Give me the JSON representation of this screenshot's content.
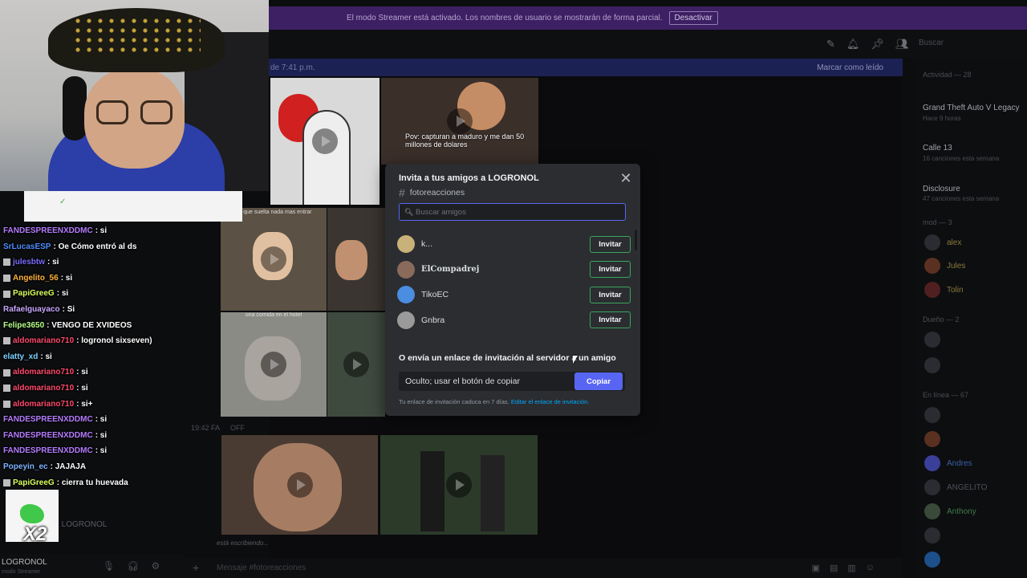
{
  "banner": {
    "text": "El modo Streamer está activado. Los nombres de usuario se mostrarán de forma parcial.",
    "button": "Desactivar"
  },
  "topbar": {
    "search_placeholder": "Buscar"
  },
  "newbar": {
    "left": "de 7:41 p.m.",
    "right": "Marcar como leído"
  },
  "chat_area": {
    "meta1": "19:42 FA",
    "meta1b": "OFF",
    "typing": "está escribiendo...",
    "message_placeholder": "Mensaje #fotoreacciones",
    "thumb_caption_1": "Pov: capturan a maduro y me dan 50 millones de dolares",
    "thumb_caption_2": "Lo que suelta nada mas entrar",
    "thumb_caption_3": "una comida en el hotel"
  },
  "right_panel": {
    "activity_header": "Actividad — 28",
    "activities": [
      {
        "title": "Grand Theft Auto V Legacy",
        "sub": "Hace 9 horas"
      },
      {
        "title": "Calle 13",
        "sub": "16 canciones esta semana"
      },
      {
        "title": "Disclosure",
        "sub": "47 canciones esta semana"
      }
    ],
    "mod_header": "mod — 3",
    "mods": [
      "alex",
      "Jules",
      "Tolin"
    ],
    "owner_header": "Dueño — 2",
    "online_header": "En línea — 67",
    "online": [
      "Andres",
      "ANGELITO",
      "Anthony"
    ]
  },
  "stream_chat": [
    {
      "user": "FANDESPREENXDDMC",
      "msg": "si",
      "color": "#b57cff",
      "badge": false
    },
    {
      "user": "SrLucasESP",
      "msg": "Oe Cómo entró al ds",
      "color": "#4f8cff",
      "badge": false
    },
    {
      "user": "julesbtw",
      "msg": "si",
      "color": "#7c6bff",
      "badge": true
    },
    {
      "user": "Angelito_56",
      "msg": "si",
      "color": "#ffb23c",
      "badge": true
    },
    {
      "user": "PapiGreeG",
      "msg": "si",
      "color": "#d8ff5b",
      "badge": true
    },
    {
      "user": "Rafaelguayaco",
      "msg": "Si",
      "color": "#c8a7ff",
      "badge": false
    },
    {
      "user": "Felipe3650",
      "msg": "VENGO DE XVIDEOS",
      "color": "#b6ff86",
      "badge": false
    },
    {
      "user": "aldomariano710",
      "msg": "logronol sixseven)",
      "color": "#ff4a6b",
      "badge": true
    },
    {
      "user": "elatty_xd",
      "msg": "si",
      "color": "#7dd3ff",
      "badge": false
    },
    {
      "user": "aldomariano710",
      "msg": "si",
      "color": "#ff4a6b",
      "badge": true
    },
    {
      "user": "aldomariano710",
      "msg": "si",
      "color": "#ff4a6b",
      "badge": true
    },
    {
      "user": "aldomariano710",
      "msg": "si+",
      "color": "#ff4a6b",
      "badge": true
    },
    {
      "user": "FANDESPREENXDDMC",
      "msg": "si",
      "color": "#b57cff",
      "badge": false
    },
    {
      "user": "FANDESPREENXDDMC",
      "msg": "si",
      "color": "#b57cff",
      "badge": false
    },
    {
      "user": "FANDESPREENXDDMC",
      "msg": "si",
      "color": "#b57cff",
      "badge": false
    },
    {
      "user": "Popeyin_ec",
      "msg": "JAJAJA",
      "color": "#7fb2ff",
      "badge": false
    },
    {
      "user": "PapiGreeG",
      "msg": "cierra tu huevada",
      "color": "#d8ff5b",
      "badge": true
    }
  ],
  "overlay": {
    "multiplier": "X2",
    "ghost_label": "DE LOGRONOL"
  },
  "left_footer": {
    "name": "LOGRONOL",
    "sub": "modo Streamer"
  },
  "modal": {
    "title": "Invita a tus amigos a LOGRONOL",
    "channel": "fotoreacciones",
    "search_placeholder": "Buscar amigos",
    "friends": [
      {
        "name": "k...",
        "bold": false,
        "avatar_color": "#c9b27a"
      },
      {
        "name": "ElCompadrej",
        "bold": true,
        "avatar_color": "#8a6a5a"
      },
      {
        "name": "TikoEC",
        "bold": false,
        "avatar_color": "#4b8de0"
      },
      {
        "name": "Gnbra",
        "bold": false,
        "avatar_color": "#9a9a9a"
      }
    ],
    "invite_label": "Invitar",
    "link_title": "O envía un enlace de invitación al servidor a un amigo",
    "link_value": "Oculto; usar el botón de copiar",
    "copy_label": "Copiar",
    "expire_text": "Tu enlace de invitación caduca en 7 días.",
    "expire_link": "Editar el enlace de invitación."
  }
}
